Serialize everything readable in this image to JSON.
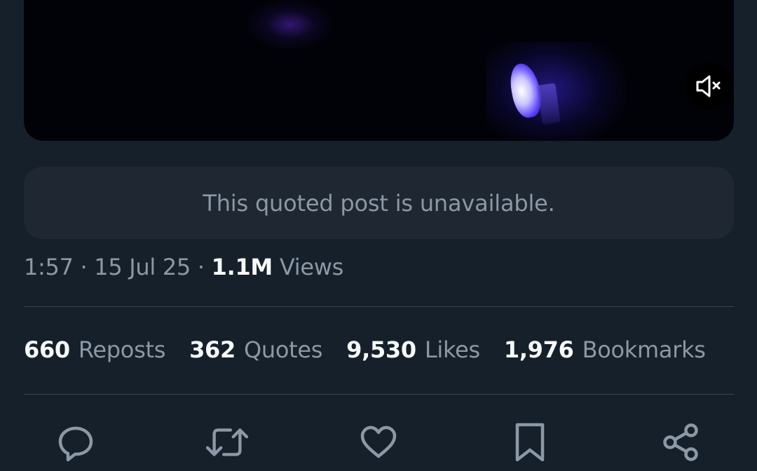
{
  "video": {
    "mute_icon": "speaker-muted-icon"
  },
  "quoted_post": {
    "message": "This quoted post is unavailable."
  },
  "meta": {
    "time": "1:57",
    "separator": " · ",
    "date": "15 Jul 25",
    "views_count": "1.1M",
    "views_label": "Views"
  },
  "stats": {
    "reposts": {
      "count": "660",
      "label": "Reposts"
    },
    "quotes": {
      "count": "362",
      "label": "Quotes"
    },
    "likes": {
      "count": "9,530",
      "label": "Likes"
    },
    "bookmarks": {
      "count": "1,976",
      "label": "Bookmarks"
    }
  },
  "actions": {
    "reply_icon": "reply-icon",
    "repost_icon": "repost-icon",
    "like_icon": "heart-icon",
    "bookmark_icon": "bookmark-icon",
    "share_icon": "share-icon"
  },
  "colors": {
    "background": "#15202b",
    "card": "#1e2732",
    "text_primary": "#f7f9f9",
    "text_secondary": "#8b98a5",
    "divider": "#38444d"
  }
}
